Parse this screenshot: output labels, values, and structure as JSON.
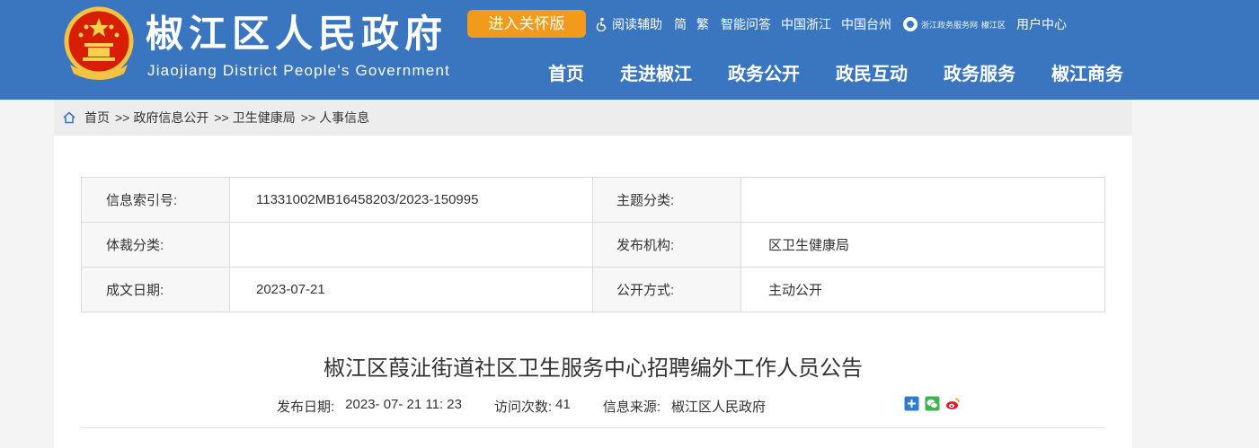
{
  "header": {
    "title": "椒江区人民政府",
    "subtitle": "Jiaojiang District People's Government",
    "care_button": "进入关怀版",
    "utils": {
      "reading_aid": "阅读辅助",
      "simplified": "简",
      "traditional": "繁",
      "qa": "智能问答",
      "zhejiang": "中国浙江",
      "taizhou": "中国台州",
      "zwfw": "浙江政务服务网",
      "zwfw_sub": "椒江区",
      "user_center": "用户中心"
    },
    "nav": [
      "首页",
      "走进椒江",
      "政务公开",
      "政民互动",
      "政务服务",
      "椒江商务"
    ]
  },
  "breadcrumb": {
    "home": "首页",
    "sep": ">>",
    "items": [
      "政府信息公开",
      "卫生健康局",
      "人事信息"
    ]
  },
  "meta_table": {
    "rows": [
      {
        "k1": "信息索引号:",
        "v1": "11331002MB16458203/2023-150995",
        "k2": "主题分类:",
        "v2": ""
      },
      {
        "k1": "体裁分类:",
        "v1": "",
        "k2": "发布机构:",
        "v2": "区卫生健康局"
      },
      {
        "k1": "成文日期:",
        "v1": "2023-07-21",
        "k2": "公开方式:",
        "v2": "主动公开"
      }
    ]
  },
  "article": {
    "title": "椒江区葭沚街道社区卫生服务中心招聘编外工作人员公告",
    "publish_label": "发布日期:",
    "publish_value": "2023- 07- 21 11: 23",
    "visits_label": "访问次数:",
    "visits_value": "41",
    "source_label": "信息来源:",
    "source_value": "椒江区人民政府"
  },
  "icons": {
    "emblem": "national-emblem-icon",
    "accessibility": "accessibility-icon",
    "home": "home-icon",
    "share": [
      "share-plus-icon",
      "wechat-icon",
      "weibo-icon"
    ]
  },
  "colors": {
    "header_bg": "#3a76bf",
    "care_button": "#f29a1c",
    "breadcrumb_bg": "#ededed"
  }
}
